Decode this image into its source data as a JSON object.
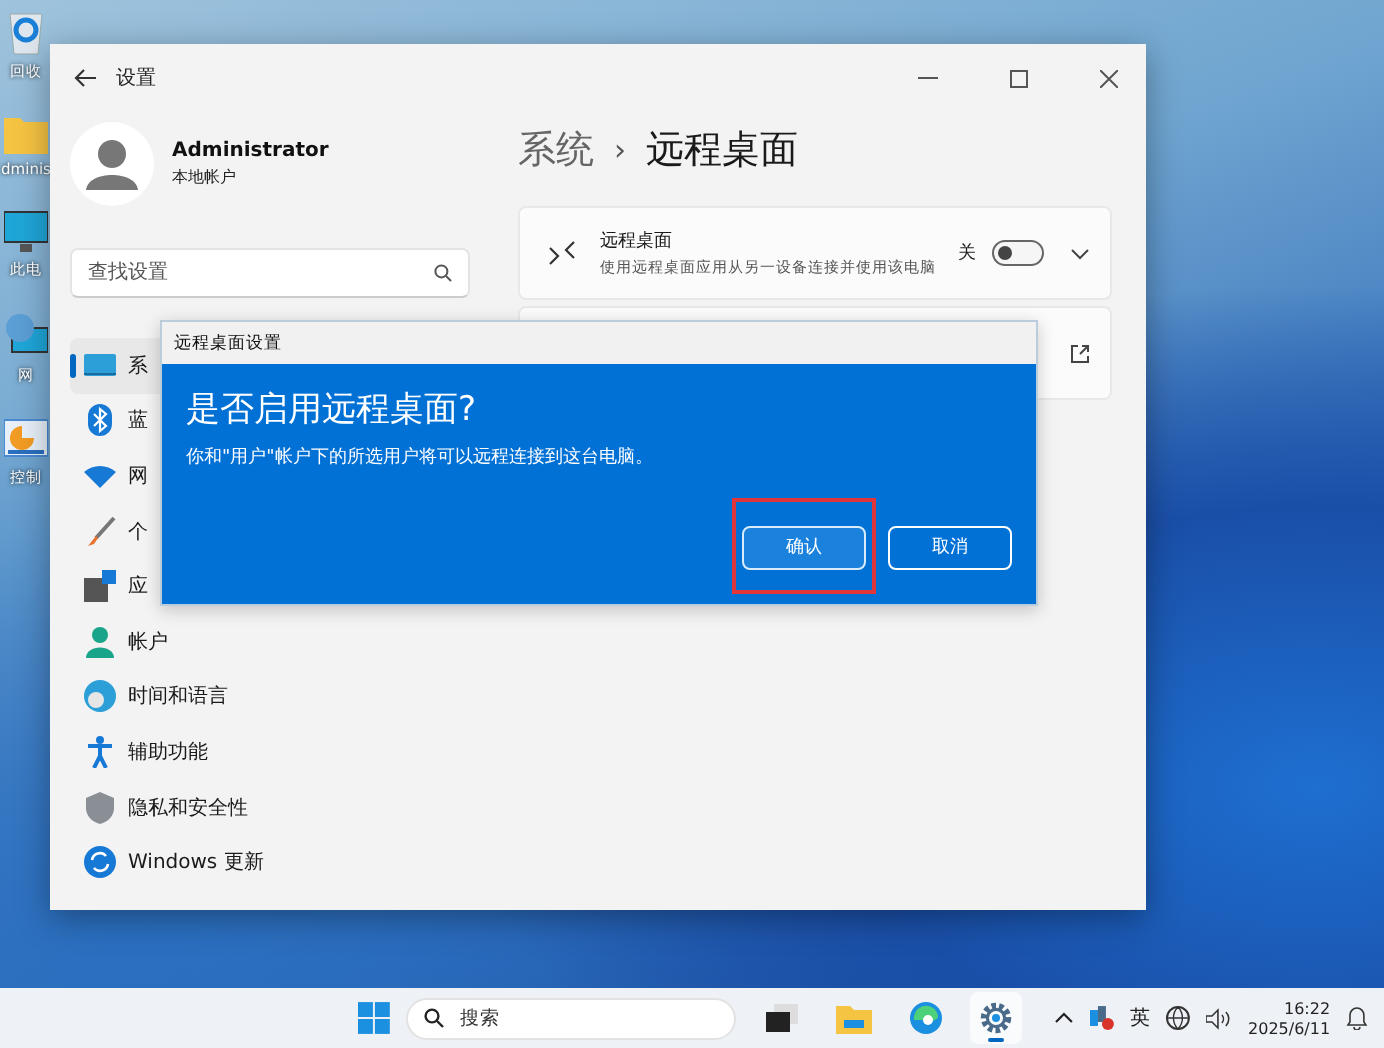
{
  "desktop_icons": [
    {
      "kind": "recycle",
      "label": "回收"
    },
    {
      "kind": "folder",
      "label": "dminis"
    },
    {
      "kind": "pc",
      "label": "此电"
    },
    {
      "kind": "network",
      "label": "网"
    },
    {
      "kind": "control",
      "label": "控制"
    }
  ],
  "window": {
    "title": "设置"
  },
  "profile": {
    "name": "Administrator",
    "account": "本地帐户"
  },
  "search": {
    "placeholder": "查找设置"
  },
  "sidebar": {
    "items": [
      {
        "kind": "system",
        "label": "系",
        "selected": true
      },
      {
        "kind": "bluetooth",
        "label": "蓝",
        "selected": false
      },
      {
        "kind": "network",
        "label": "网",
        "selected": false
      },
      {
        "kind": "personalize",
        "label": "个",
        "selected": false
      },
      {
        "kind": "apps",
        "label": "应",
        "selected": false
      },
      {
        "kind": "accounts",
        "label": "帐户",
        "selected": false
      },
      {
        "kind": "time",
        "label": "时间和语言",
        "selected": false
      },
      {
        "kind": "accessibility",
        "label": "辅助功能",
        "selected": false
      },
      {
        "kind": "privacy",
        "label": "隐私和安全性",
        "selected": false
      },
      {
        "kind": "update",
        "label": "Windows 更新",
        "selected": false
      }
    ]
  },
  "breadcrumb": {
    "parent": "系统",
    "separator": "›",
    "current": "远程桌面"
  },
  "remote_card": {
    "title": "远程桌面",
    "description": "使用远程桌面应用从另一设备连接并使用该电脑",
    "state_label": "关",
    "on": false
  },
  "dialog": {
    "title": "远程桌面设置",
    "heading": "是否启用远程桌面?",
    "message": "你和\"用户\"帐户下的所选用户将可以远程连接到这台电脑。",
    "buttons": [
      {
        "label": "确认",
        "default": true,
        "highlighted": true
      },
      {
        "label": "取消",
        "default": false,
        "highlighted": false
      }
    ]
  },
  "taskbar": {
    "search_placeholder": "搜索",
    "apps": [
      {
        "kind": "taskview",
        "active": false
      },
      {
        "kind": "explorer",
        "active": false
      },
      {
        "kind": "edge",
        "active": false
      },
      {
        "kind": "settings",
        "active": true
      }
    ],
    "input_method": "英",
    "time": "16:22",
    "date": "2025/6/11"
  }
}
